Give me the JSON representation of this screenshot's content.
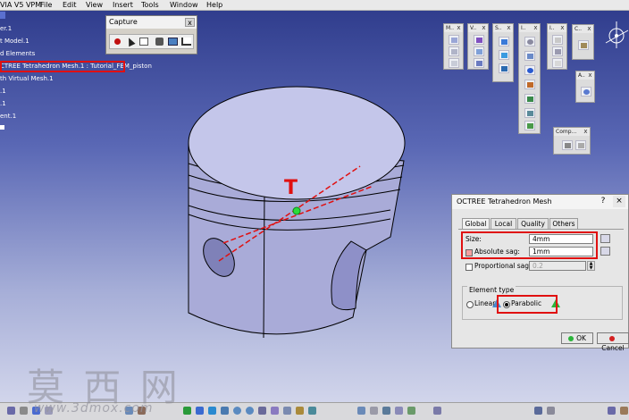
{
  "menubar": {
    "app_title": "VIA V5 VPM",
    "items": [
      "File",
      "Edit",
      "View",
      "Insert",
      "Tools",
      "Window",
      "Help"
    ]
  },
  "tree": {
    "items": [
      "er.1",
      "t Model.1",
      "d Elements",
      "CTREE Tetrahedron Mesh.1 : Tutorial_FEM_piston",
      "th Virtual Mesh.1",
      ".1",
      ".1",
      "ent.1"
    ]
  },
  "capture": {
    "title": "Capture",
    "close_label": "x",
    "icons": [
      "record-icon",
      "select-icon",
      "capture-icon",
      "view-icon",
      "image-icon",
      "chart-icon"
    ]
  },
  "toolbars": [
    {
      "label": "M..",
      "close": "x"
    },
    {
      "label": "V..",
      "close": "x"
    },
    {
      "label": "S..",
      "close": "x"
    },
    {
      "label": "I..",
      "close": "x"
    },
    {
      "label": "I..",
      "close": "x"
    },
    {
      "label": "C..",
      "close": "x"
    },
    {
      "label": "A..",
      "close": "x"
    },
    {
      "label": "Comp...",
      "close": "x"
    }
  ],
  "viewport": {
    "load_marker": "T",
    "colors": {
      "piston_fill": "#a9abd8",
      "piston_top": "#c4c6ea",
      "edge": "#000000",
      "annotation": "#e01010"
    }
  },
  "dialog": {
    "title": "OCTREE Tetrahedron Mesh",
    "help": "?",
    "close": "×",
    "tabs": [
      {
        "label": "Global",
        "active": true
      },
      {
        "label": "Local",
        "active": false
      },
      {
        "label": "Quality",
        "active": false
      },
      {
        "label": "Others",
        "active": false
      }
    ],
    "size": {
      "label": "Size:",
      "value": "4mm"
    },
    "absolute_sag": {
      "label": "Absolute sag:",
      "value": "1mm",
      "checked": true
    },
    "proportional_sag": {
      "label": "Proportional sag:",
      "value": "0.2",
      "checked": false
    },
    "element_type": {
      "label": "Element type",
      "options": [
        {
          "label": "Linear",
          "selected": false
        },
        {
          "label": "Parabolic",
          "selected": true
        }
      ]
    },
    "ok": "OK",
    "cancel": "Cancel"
  },
  "watermark": {
    "text": "莫 西 网",
    "url": "www.3dmox.com"
  }
}
